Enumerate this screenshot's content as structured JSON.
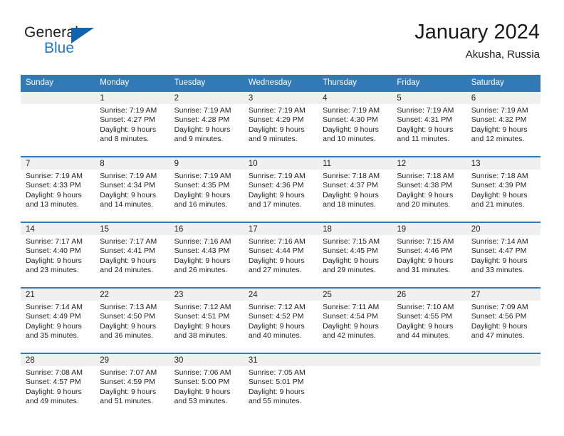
{
  "brand": {
    "name_part1": "General",
    "name_part2": "Blue"
  },
  "header": {
    "title": "January 2024",
    "subtitle": "Akusha, Russia"
  },
  "weekday_headers": [
    "Sunday",
    "Monday",
    "Tuesday",
    "Wednesday",
    "Thursday",
    "Friday",
    "Saturday"
  ],
  "colors": {
    "header_blue": "#3279b8",
    "logo_blue": "#2277c8",
    "daynum_band": "#f0f0f0",
    "text": "#222222"
  },
  "weeks": [
    [
      {
        "day": "",
        "sunrise": "",
        "sunset": "",
        "daylight": ""
      },
      {
        "day": "1",
        "sunrise": "Sunrise: 7:19 AM",
        "sunset": "Sunset: 4:27 PM",
        "daylight": "Daylight: 9 hours and 8 minutes."
      },
      {
        "day": "2",
        "sunrise": "Sunrise: 7:19 AM",
        "sunset": "Sunset: 4:28 PM",
        "daylight": "Daylight: 9 hours and 9 minutes."
      },
      {
        "day": "3",
        "sunrise": "Sunrise: 7:19 AM",
        "sunset": "Sunset: 4:29 PM",
        "daylight": "Daylight: 9 hours and 9 minutes."
      },
      {
        "day": "4",
        "sunrise": "Sunrise: 7:19 AM",
        "sunset": "Sunset: 4:30 PM",
        "daylight": "Daylight: 9 hours and 10 minutes."
      },
      {
        "day": "5",
        "sunrise": "Sunrise: 7:19 AM",
        "sunset": "Sunset: 4:31 PM",
        "daylight": "Daylight: 9 hours and 11 minutes."
      },
      {
        "day": "6",
        "sunrise": "Sunrise: 7:19 AM",
        "sunset": "Sunset: 4:32 PM",
        "daylight": "Daylight: 9 hours and 12 minutes."
      }
    ],
    [
      {
        "day": "7",
        "sunrise": "Sunrise: 7:19 AM",
        "sunset": "Sunset: 4:33 PM",
        "daylight": "Daylight: 9 hours and 13 minutes."
      },
      {
        "day": "8",
        "sunrise": "Sunrise: 7:19 AM",
        "sunset": "Sunset: 4:34 PM",
        "daylight": "Daylight: 9 hours and 14 minutes."
      },
      {
        "day": "9",
        "sunrise": "Sunrise: 7:19 AM",
        "sunset": "Sunset: 4:35 PM",
        "daylight": "Daylight: 9 hours and 16 minutes."
      },
      {
        "day": "10",
        "sunrise": "Sunrise: 7:19 AM",
        "sunset": "Sunset: 4:36 PM",
        "daylight": "Daylight: 9 hours and 17 minutes."
      },
      {
        "day": "11",
        "sunrise": "Sunrise: 7:18 AM",
        "sunset": "Sunset: 4:37 PM",
        "daylight": "Daylight: 9 hours and 18 minutes."
      },
      {
        "day": "12",
        "sunrise": "Sunrise: 7:18 AM",
        "sunset": "Sunset: 4:38 PM",
        "daylight": "Daylight: 9 hours and 20 minutes."
      },
      {
        "day": "13",
        "sunrise": "Sunrise: 7:18 AM",
        "sunset": "Sunset: 4:39 PM",
        "daylight": "Daylight: 9 hours and 21 minutes."
      }
    ],
    [
      {
        "day": "14",
        "sunrise": "Sunrise: 7:17 AM",
        "sunset": "Sunset: 4:40 PM",
        "daylight": "Daylight: 9 hours and 23 minutes."
      },
      {
        "day": "15",
        "sunrise": "Sunrise: 7:17 AM",
        "sunset": "Sunset: 4:41 PM",
        "daylight": "Daylight: 9 hours and 24 minutes."
      },
      {
        "day": "16",
        "sunrise": "Sunrise: 7:16 AM",
        "sunset": "Sunset: 4:43 PM",
        "daylight": "Daylight: 9 hours and 26 minutes."
      },
      {
        "day": "17",
        "sunrise": "Sunrise: 7:16 AM",
        "sunset": "Sunset: 4:44 PM",
        "daylight": "Daylight: 9 hours and 27 minutes."
      },
      {
        "day": "18",
        "sunrise": "Sunrise: 7:15 AM",
        "sunset": "Sunset: 4:45 PM",
        "daylight": "Daylight: 9 hours and 29 minutes."
      },
      {
        "day": "19",
        "sunrise": "Sunrise: 7:15 AM",
        "sunset": "Sunset: 4:46 PM",
        "daylight": "Daylight: 9 hours and 31 minutes."
      },
      {
        "day": "20",
        "sunrise": "Sunrise: 7:14 AM",
        "sunset": "Sunset: 4:47 PM",
        "daylight": "Daylight: 9 hours and 33 minutes."
      }
    ],
    [
      {
        "day": "21",
        "sunrise": "Sunrise: 7:14 AM",
        "sunset": "Sunset: 4:49 PM",
        "daylight": "Daylight: 9 hours and 35 minutes."
      },
      {
        "day": "22",
        "sunrise": "Sunrise: 7:13 AM",
        "sunset": "Sunset: 4:50 PM",
        "daylight": "Daylight: 9 hours and 36 minutes."
      },
      {
        "day": "23",
        "sunrise": "Sunrise: 7:12 AM",
        "sunset": "Sunset: 4:51 PM",
        "daylight": "Daylight: 9 hours and 38 minutes."
      },
      {
        "day": "24",
        "sunrise": "Sunrise: 7:12 AM",
        "sunset": "Sunset: 4:52 PM",
        "daylight": "Daylight: 9 hours and 40 minutes."
      },
      {
        "day": "25",
        "sunrise": "Sunrise: 7:11 AM",
        "sunset": "Sunset: 4:54 PM",
        "daylight": "Daylight: 9 hours and 42 minutes."
      },
      {
        "day": "26",
        "sunrise": "Sunrise: 7:10 AM",
        "sunset": "Sunset: 4:55 PM",
        "daylight": "Daylight: 9 hours and 44 minutes."
      },
      {
        "day": "27",
        "sunrise": "Sunrise: 7:09 AM",
        "sunset": "Sunset: 4:56 PM",
        "daylight": "Daylight: 9 hours and 47 minutes."
      }
    ],
    [
      {
        "day": "28",
        "sunrise": "Sunrise: 7:08 AM",
        "sunset": "Sunset: 4:57 PM",
        "daylight": "Daylight: 9 hours and 49 minutes."
      },
      {
        "day": "29",
        "sunrise": "Sunrise: 7:07 AM",
        "sunset": "Sunset: 4:59 PM",
        "daylight": "Daylight: 9 hours and 51 minutes."
      },
      {
        "day": "30",
        "sunrise": "Sunrise: 7:06 AM",
        "sunset": "Sunset: 5:00 PM",
        "daylight": "Daylight: 9 hours and 53 minutes."
      },
      {
        "day": "31",
        "sunrise": "Sunrise: 7:05 AM",
        "sunset": "Sunset: 5:01 PM",
        "daylight": "Daylight: 9 hours and 55 minutes."
      },
      {
        "day": "",
        "sunrise": "",
        "sunset": "",
        "daylight": ""
      },
      {
        "day": "",
        "sunrise": "",
        "sunset": "",
        "daylight": ""
      },
      {
        "day": "",
        "sunrise": "",
        "sunset": "",
        "daylight": ""
      }
    ]
  ]
}
